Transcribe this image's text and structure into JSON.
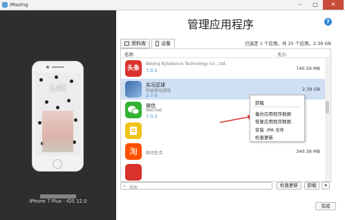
{
  "window": {
    "title": "iMazing"
  },
  "device": {
    "name": "iPhone 7 Plus - iOS 12.0",
    "lock_time": "1:41"
  },
  "page": {
    "title": "管理应用程序",
    "help": "?"
  },
  "tabs": [
    {
      "label": "资料库"
    },
    {
      "label": "设备"
    }
  ],
  "status_text": "已选定 1 个应用，共 25 个应用，2.39 GB",
  "columns": {
    "name": "名称",
    "size": "大小"
  },
  "apps": [
    {
      "name": "",
      "vendor": "Beijing Bytedance Technology Co., Ltd.",
      "version": "7.0.5",
      "size": "740.59 MB",
      "icon_color": "#d9312c",
      "icon_text": "头条"
    },
    {
      "name": "实况足球",
      "vendor": "网易移动游戏",
      "version": "2.7.0",
      "size": "2.39 GB",
      "icon_color": "#3a6aa8",
      "icon_text": ""
    },
    {
      "name": "微信",
      "vendor": "WeChat",
      "version": "7.0.2",
      "size": "",
      "icon_color": "#34b233",
      "icon_text": ""
    },
    {
      "name": "",
      "vendor": "",
      "version": "",
      "size": "",
      "icon_color": "#f0c419",
      "icon_text": ""
    },
    {
      "name": "",
      "vendor": "移动生活",
      "version": "",
      "size": "340.39 MB",
      "icon_color": "#ff5000",
      "icon_text": "淘"
    },
    {
      "name": "",
      "vendor": "",
      "version": "",
      "size": "",
      "icon_color": "#d9312c",
      "icon_text": ""
    }
  ],
  "context_menu": [
    "卸载",
    "备份应用程序数据",
    "恢复应用程序数据",
    "安装 .IPA 文件",
    "检查更新"
  ],
  "search": {
    "placeholder": "搜索"
  },
  "buttons": {
    "check_updates": "检查更新",
    "uninstall": "卸载",
    "done": "完成"
  },
  "colors": {
    "accent": "#2a86d8",
    "selection": "#cfe0f5",
    "sidebar": "#2e2e2e",
    "arrow": "#d9312c"
  }
}
